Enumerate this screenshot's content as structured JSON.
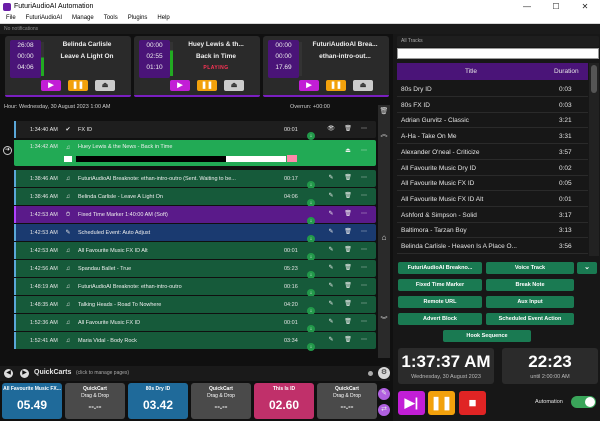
{
  "window": {
    "title": "FuturiAudioAI Automation",
    "controls": [
      "—",
      "☐",
      "✕"
    ]
  },
  "menu": [
    "File",
    "FuturiAudioAI",
    "Manage",
    "Tools",
    "Plugins",
    "Help"
  ],
  "notifications": "No notifications",
  "players": [
    {
      "t1": "26:08",
      "t2": "00:00",
      "t3": "04:06",
      "artist": "Belinda Carlisle",
      "title": "Leave A Light On",
      "status": ""
    },
    {
      "t1": "00:00",
      "t2": "02:55",
      "t3": "01:10",
      "artist": "Huey Lewis & th...",
      "title": "Back in Time",
      "status": "PLAYING"
    },
    {
      "t1": "00:00",
      "t2": "00:00",
      "t3": "17.69",
      "artist": "FuturiAudioAI Brea...",
      "title": "ethan-intro-out...",
      "status": ""
    }
  ],
  "hour": {
    "label": "Hour: Wednesday, 30 August 2023 1:00 AM",
    "overrun": "Overrun: +00:00"
  },
  "playlist": [
    {
      "time": "1:34:40 AM",
      "text": "FX ID",
      "dur": "00:01",
      "color": "#1e1e1e",
      "stripe": "#5aa7d8",
      "icon": "✔"
    },
    {
      "time": "1:34:42 AM",
      "text": "Huey Lewis & the News - Back in Time",
      "dur": "",
      "color": "#22aa55",
      "stripe": "#22aa55",
      "icon": "♫"
    },
    {
      "time": "1:38:46 AM",
      "text": "FuturiAudioAI Breaknote: ethan-intro-outro (Sent. Waiting to be...",
      "dur": "00:17",
      "color": "#165a3a",
      "stripe": "#5aa7d8",
      "icon": "♫"
    },
    {
      "time": "1:38:46 AM",
      "text": "Belinda Carlisle - Leave A Light On",
      "dur": "04:06",
      "color": "#165a3a",
      "stripe": "#5aa7d8",
      "icon": "♫"
    },
    {
      "time": "1:42:53 AM",
      "text": "Fixed Time Marker 1:40:00 AM (Soft)",
      "dur": "",
      "color": "#5a1a8a",
      "stripe": "#b040ff",
      "icon": "⏱"
    },
    {
      "time": "1:42:53 AM",
      "text": "Scheduled Event: Auto Adjust",
      "dur": "",
      "color": "#1a3a70",
      "stripe": "#5aa7d8",
      "icon": "✎"
    },
    {
      "time": "1:42:53 AM",
      "text": "All Favourite Music FX ID Alt",
      "dur": "00:01",
      "color": "#165a3a",
      "stripe": "#5aa7d8",
      "icon": "♫"
    },
    {
      "time": "1:42:56 AM",
      "text": "Spandau Ballet - True",
      "dur": "05:23",
      "color": "#165a3a",
      "stripe": "#5aa7d8",
      "icon": "♫"
    },
    {
      "time": "1:48:19 AM",
      "text": "FuturiAudioAI Breaknote: ethan-intro-outro",
      "dur": "00:16",
      "color": "#165a3a",
      "stripe": "#5aa7d8",
      "icon": "♫"
    },
    {
      "time": "1:48:35 AM",
      "text": "Talking Heads - Road To Nowhere",
      "dur": "04:20",
      "color": "#165a3a",
      "stripe": "#5aa7d8",
      "icon": "♫"
    },
    {
      "time": "1:52:36 AM",
      "text": "All Favourite Music FX ID",
      "dur": "00:01",
      "color": "#165a3a",
      "stripe": "#5aa7d8",
      "icon": "♫"
    },
    {
      "time": "1:52:41 AM",
      "text": "Maria Vidal - Body Rock",
      "dur": "03:34",
      "color": "#165a3a",
      "stripe": "#5aa7d8",
      "icon": "♫"
    }
  ],
  "quickcarts": {
    "label": "QuickCarts",
    "hint": "(click to manage pages)",
    "carts": [
      {
        "title": "All Favourite Music FX...",
        "sub": "",
        "value": "05.49",
        "color": "#1f6a9a"
      },
      {
        "title": "QuickCart",
        "sub": "Drag & Drop",
        "value": "--.--",
        "color": "#4a4a4a"
      },
      {
        "title": "80s Dry ID",
        "sub": "",
        "value": "03.42",
        "color": "#1f6a9a"
      },
      {
        "title": "QuickCart",
        "sub": "Drag & Drop",
        "value": "--.--",
        "color": "#4a4a4a"
      },
      {
        "title": "This Is ID",
        "sub": "",
        "value": "02.60",
        "color": "#c0306a"
      },
      {
        "title": "QuickCart",
        "sub": "Drag & Drop",
        "value": "--.--",
        "color": "#4a4a4a"
      }
    ]
  },
  "library": {
    "filter": "All Tracks",
    "search_placeholder": "",
    "col_title": "Title",
    "col_duration": "Duration",
    "rows": [
      {
        "title": "80s Dry ID",
        "dur": "0:03"
      },
      {
        "title": "80s FX ID",
        "dur": "0:03"
      },
      {
        "title": "Adrian Gurvitz - Classic",
        "dur": "3:21"
      },
      {
        "title": "A-Ha - Take On Me",
        "dur": "3:31"
      },
      {
        "title": "Alexander O'neal - Criticize",
        "dur": "3:57"
      },
      {
        "title": "All Favourite Music Dry ID",
        "dur": "0:02"
      },
      {
        "title": "All Favourite Music FX ID",
        "dur": "0:05"
      },
      {
        "title": "All Favourite Music FX ID Alt",
        "dur": "0:01"
      },
      {
        "title": "Ashford & Simpson - Solid",
        "dur": "3:17"
      },
      {
        "title": "Baltimora - Tarzan Boy",
        "dur": "3:13"
      },
      {
        "title": "Belinda Carlisle - Heaven Is A Place O...",
        "dur": "3:56"
      }
    ]
  },
  "actions": {
    "breaknote": "FuturiAudioAI Breakno...",
    "voicetrack": "Voice Track",
    "fixed_marker": "Fixed Time Marker",
    "break_note": "Break Note",
    "remote_url": "Remote URL",
    "aux_input": "Aux Input",
    "advert_block": "Advert Block",
    "scheduled_event": "Scheduled Event Action",
    "hook_sequence": "Hook Sequence"
  },
  "clock_time": {
    "time": "1:37:37 AM",
    "date": "Wednesday, 30 August 2023"
  },
  "clock_until": {
    "time": "22:23",
    "label": "until 2:00:00 AM"
  },
  "automation": {
    "label": "Automation",
    "on": true
  },
  "colors": {
    "accent": "#7a1fc0",
    "green": "#1a7a52",
    "pause": "#f2a10c",
    "stop": "#e02424",
    "play": "#c21ed6"
  }
}
